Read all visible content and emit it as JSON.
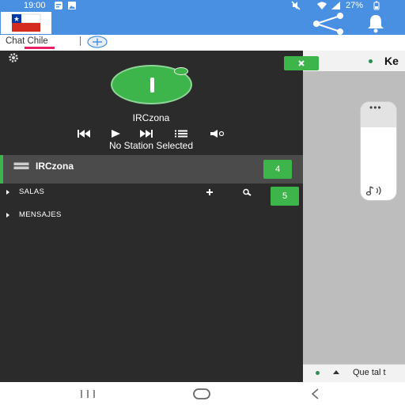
{
  "status_bar": {
    "time": "19:00",
    "battery": "27%",
    "icons": [
      "notification-icon",
      "gallery-icon",
      "mute-icon",
      "wifi-icon",
      "signal-icon",
      "battery-icon"
    ]
  },
  "app_bar": {
    "flag": "chile-flag-icon",
    "actions": [
      "share-icon",
      "bell-icon"
    ]
  },
  "tabs": {
    "active_label": "Chat Chile",
    "add_icon": "add-tab-icon"
  },
  "player": {
    "station": "IRCzona",
    "status": "No Station Selected",
    "controls": [
      "previous-icon",
      "play-icon",
      "next-icon",
      "list-icon",
      "volume-icon"
    ]
  },
  "sidebar": {
    "server": {
      "name": "IRCzona",
      "badge": "4"
    },
    "sections": [
      {
        "label": "SALAS",
        "badge": "5"
      },
      {
        "label": "MENSAJES"
      }
    ]
  },
  "chat": {
    "header_title": "Ke",
    "close_icon": "close-icon",
    "input_text": "Que tal t"
  },
  "colors": {
    "app_bar": "#4a90e2",
    "accent_green": "#3eb54a",
    "tab_underline": "#e91e63",
    "panel_dark": "#2b2b2b",
    "server_row": "#4b4b4b"
  }
}
